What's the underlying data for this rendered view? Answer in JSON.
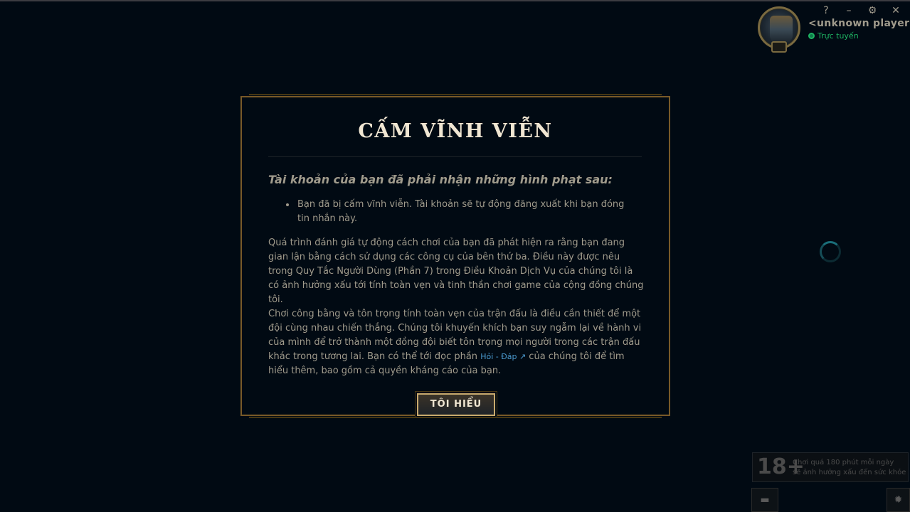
{
  "player": {
    "name": "<unknown player>",
    "status": "Trực tuyến"
  },
  "window_controls": {
    "help": "?",
    "minimize": "–",
    "settings": "⚙",
    "close": "✕"
  },
  "modal": {
    "title": "CẤM VĨNH VIỄN",
    "subheading": "Tài khoản của bạn đã phải nhận những hình phạt sau:",
    "bullets": [
      "Bạn đã bị cấm vĩnh viễn. Tài khoản sẽ tự động đăng xuất khi bạn đóng tin nhắn này."
    ],
    "paragraph1": "Quá trình đánh giá tự động cách chơi của bạn đã phát hiện ra rằng bạn đang gian lận bằng cách sử dụng các công cụ của bên thứ ba. Điều này được nêu trong Quy Tắc Người Dùng (Phần 7) trong Điều Khoản Dịch Vụ của chúng tôi là có ảnh hưởng xấu tới tính toàn vẹn và tinh thần chơi game của cộng đồng chúng tôi.",
    "paragraph2_before_link": "Chơi công bằng và tôn trọng tính toàn vẹn của trận đấu là điều cần thiết để một đội cùng nhau chiến thắng. Chúng tôi khuyến khích bạn suy ngẫm lại về hành vi của mình để trở thành một đồng đội biết tôn trọng mọi người trong các trận đấu khác trong tương lai. Bạn có thể tới đọc phần ",
    "faq_link": "Hỏi - Đáp ↗",
    "paragraph2_after_link": " của chúng tôi để tìm hiểu thêm, bao gồm cả quyền kháng cáo của bạn.",
    "ok_button": "TÔI HIỂU"
  },
  "age_notice": {
    "rating": "18+",
    "text_line1": "Chơi quá 180 phút mỗi ngày",
    "text_line2": "sẽ ảnh hưởng xấu đến sức khỏe"
  }
}
